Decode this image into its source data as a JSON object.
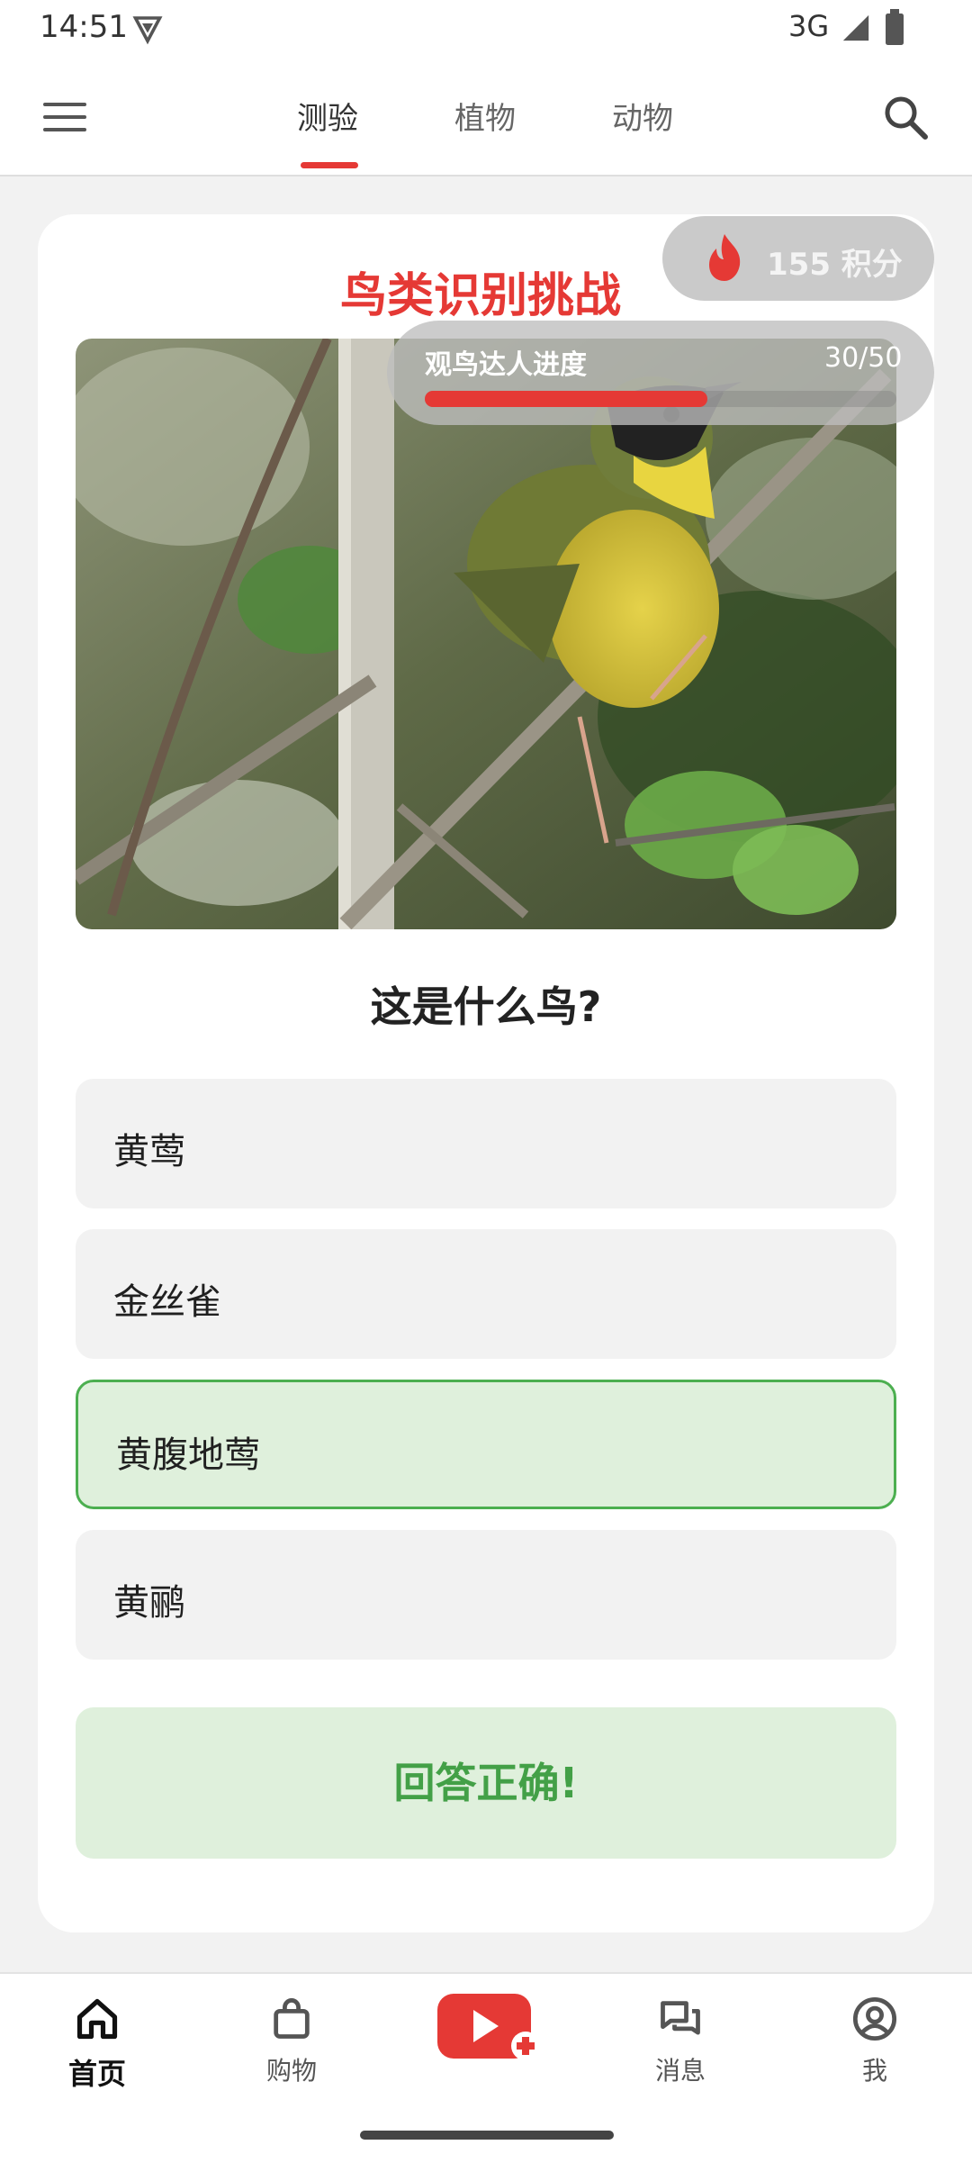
{
  "status": {
    "time": "14:51",
    "network": "3G"
  },
  "tabs": [
    {
      "label": "测验",
      "active": true
    },
    {
      "label": "植物",
      "active": false
    },
    {
      "label": "动物",
      "active": false
    }
  ],
  "title": "鸟类识别挑战",
  "points": "155 积分",
  "progress": {
    "label": "观鸟达人进度",
    "count": "30/50",
    "fraction": 0.6
  },
  "question": "这是什么鸟?",
  "options": [
    {
      "label": "黄莺",
      "state": "normal"
    },
    {
      "label": "金丝雀",
      "state": "normal"
    },
    {
      "label": "黄腹地莺",
      "state": "correct"
    },
    {
      "label": "黄鹂",
      "state": "normal"
    }
  ],
  "result": "回答正确!",
  "bottom_nav": [
    {
      "label": "首页",
      "icon": "home-icon",
      "active": true
    },
    {
      "label": "购物",
      "icon": "shopping-bag-icon",
      "active": false
    },
    {
      "label": "",
      "icon": "create-video-icon",
      "active": false
    },
    {
      "label": "消息",
      "icon": "messages-icon",
      "active": false
    },
    {
      "label": "我",
      "icon": "profile-icon",
      "active": false
    }
  ],
  "colors": {
    "accent": "#e53935",
    "correct": "#43a047",
    "correct_bg": "#dff0dc"
  }
}
